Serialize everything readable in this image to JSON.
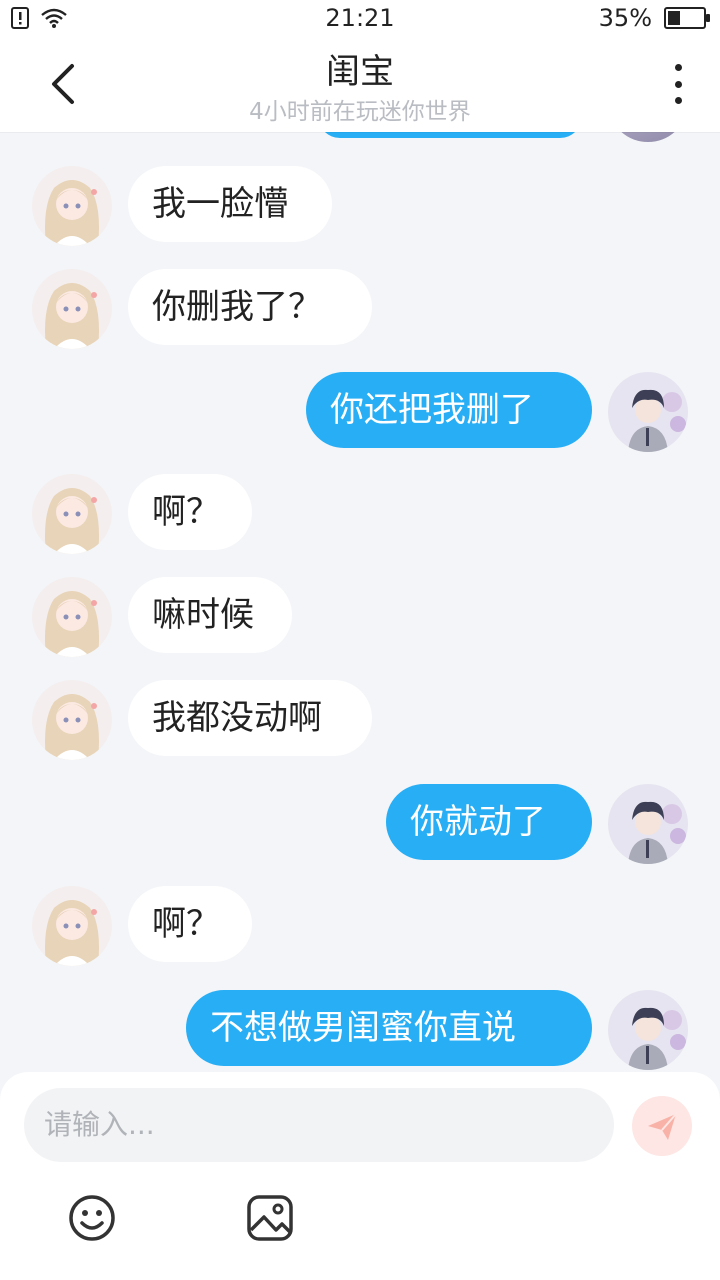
{
  "status_bar": {
    "time": "21:21",
    "battery": "35%",
    "battery_level": 0.35
  },
  "header": {
    "title": "闺宝",
    "subtitle": "4小时前在玩迷你世界"
  },
  "messages": [
    {
      "side": "in",
      "text": "我一脸懵"
    },
    {
      "side": "in",
      "text": "你删我了？"
    },
    {
      "side": "out",
      "text": "你还把我删了"
    },
    {
      "side": "in",
      "text": "啊？"
    },
    {
      "side": "in",
      "text": "嘛时候"
    },
    {
      "side": "in",
      "text": "我都没动啊"
    },
    {
      "side": "out",
      "text": "你就动了"
    },
    {
      "side": "in",
      "text": "啊？"
    },
    {
      "side": "out",
      "text": "不想做男闺蜜你直说"
    }
  ],
  "input": {
    "placeholder": "请输入..."
  },
  "colors": {
    "accent": "#27aef5",
    "background": "#f3f5f8",
    "send_disabled": "#fde6e3"
  },
  "icons": [
    "back-icon",
    "more-icon",
    "send-icon",
    "emoji-icon",
    "image-icon",
    "wifi-icon",
    "sim-alert-icon",
    "battery-icon"
  ]
}
